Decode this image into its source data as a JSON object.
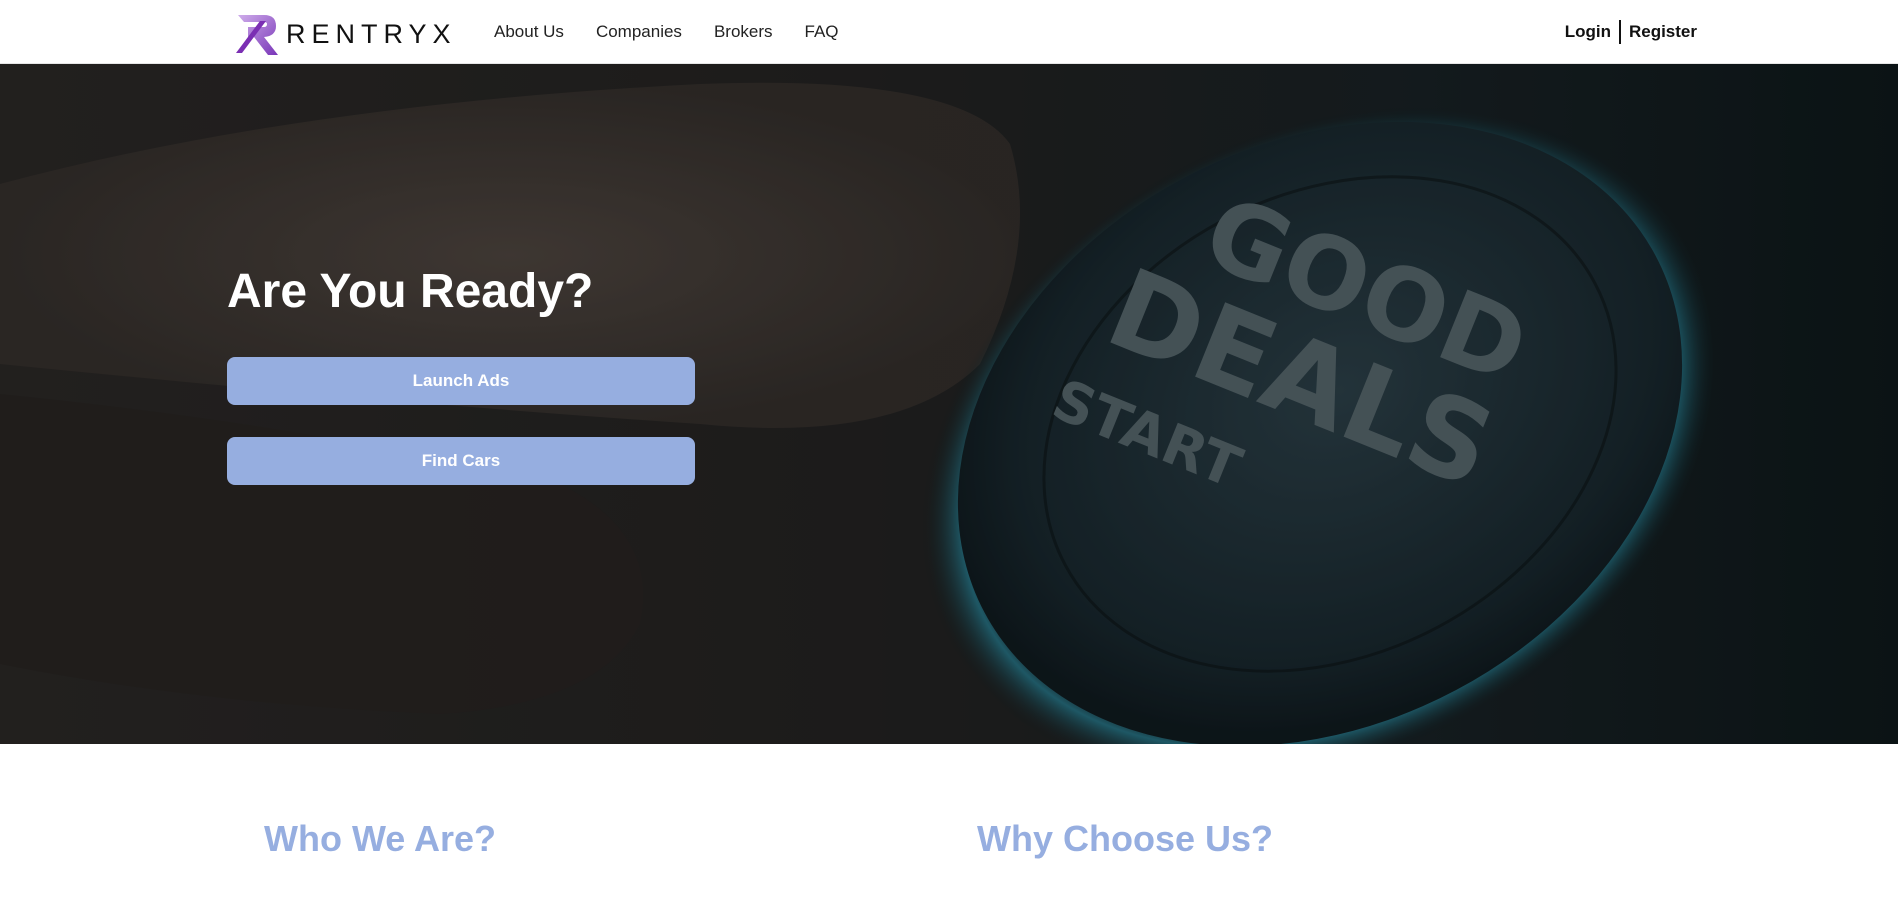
{
  "brand": {
    "name": "RENTRYX",
    "colors": {
      "accent": "#96aee0",
      "logo_purple": "#7b2fb3"
    }
  },
  "nav": {
    "items": [
      {
        "label": "About Us"
      },
      {
        "label": "Companies"
      },
      {
        "label": "Brokers"
      },
      {
        "label": "FAQ"
      }
    ]
  },
  "auth": {
    "login": "Login",
    "register": "Register"
  },
  "hero": {
    "title": "Are You Ready?",
    "buttons": {
      "launch_ads": "Launch Ads",
      "find_cars": "Find Cars"
    },
    "image_text": {
      "line1": "GOOD",
      "line2": "DEALS",
      "line3": "START"
    }
  },
  "sections": {
    "who": "Who We Are?",
    "why": "Why Choose Us?"
  }
}
